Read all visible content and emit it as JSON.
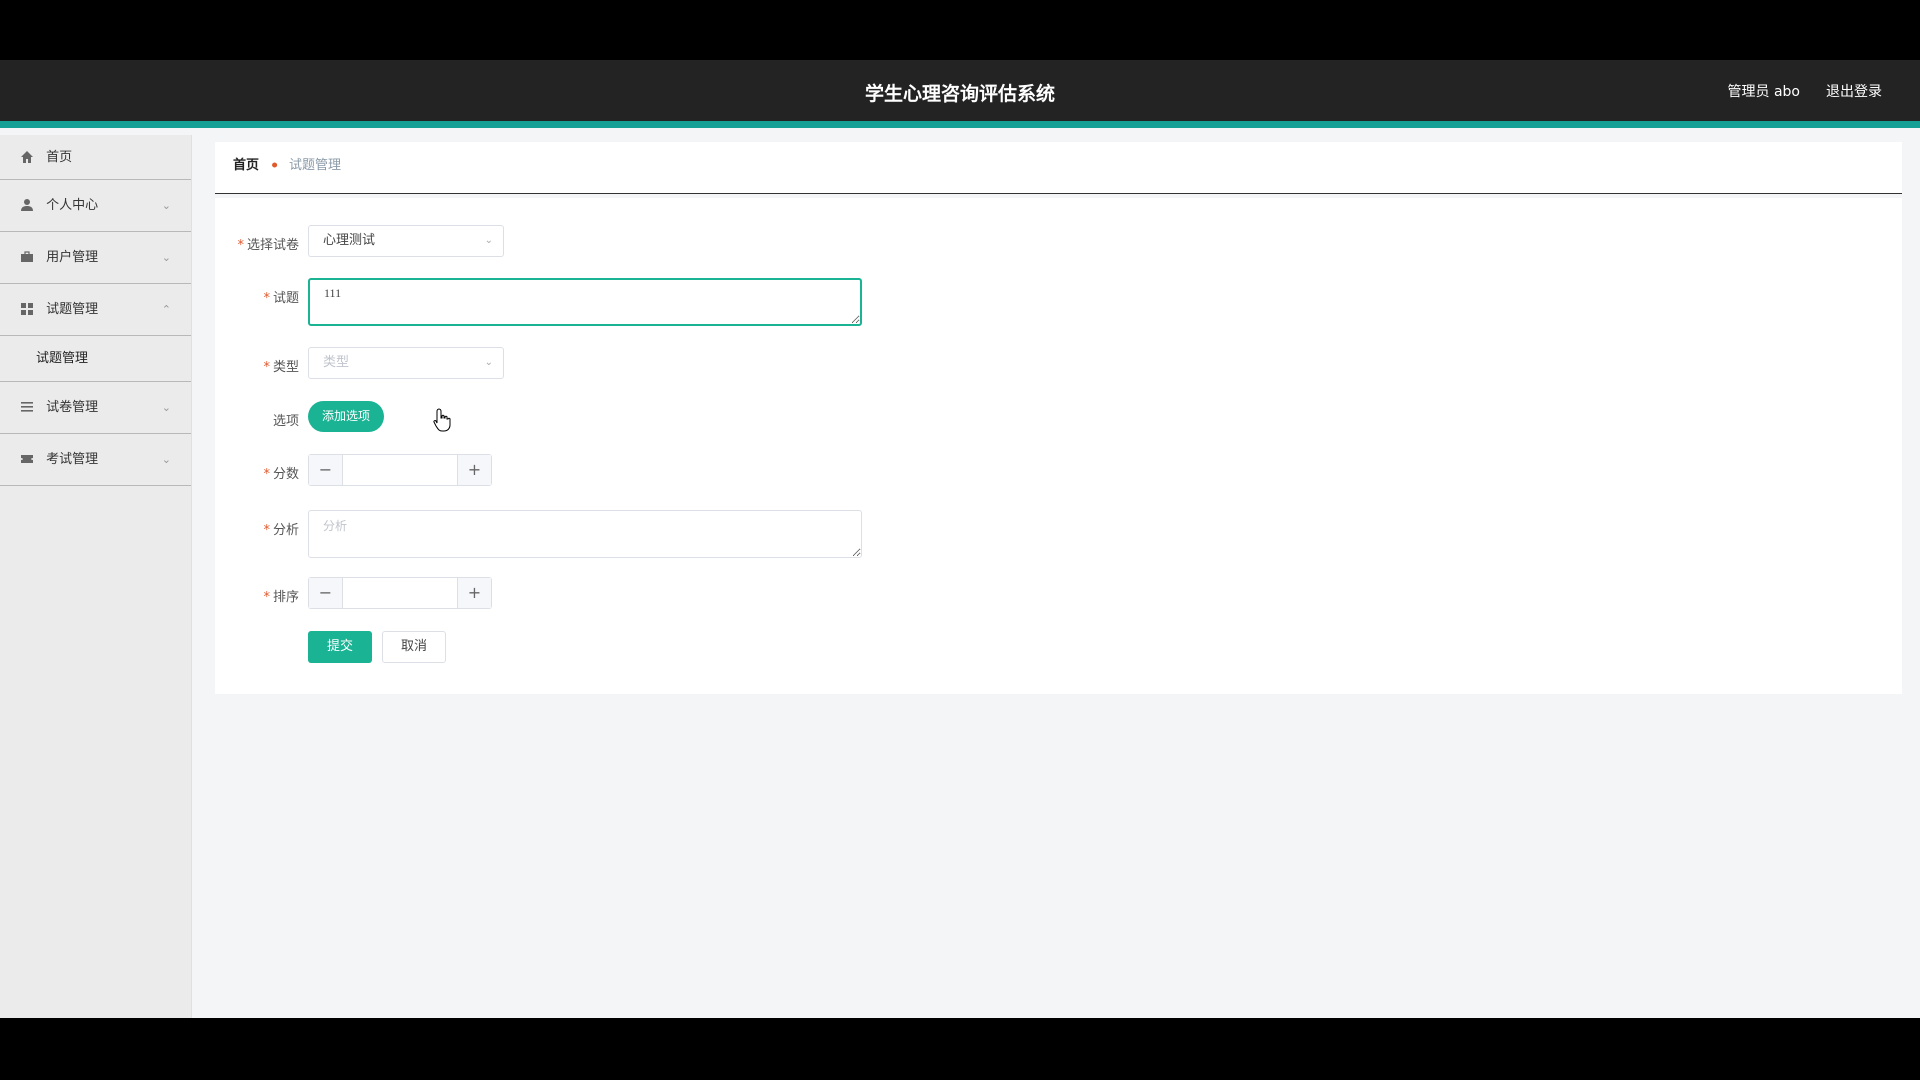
{
  "header": {
    "title": "学生心理咨询评估系统",
    "user": "管理员 abo",
    "logout": "退出登录"
  },
  "sidebar": {
    "items": [
      {
        "label": "首页",
        "icon": "home-icon"
      },
      {
        "label": "个人中心",
        "icon": "user-icon"
      },
      {
        "label": "用户管理",
        "icon": "briefcase-icon"
      },
      {
        "label": "试题管理",
        "icon": "grid-icon",
        "expanded": true
      },
      {
        "label": "试卷管理",
        "icon": "list-icon"
      },
      {
        "label": "考试管理",
        "icon": "ticket-icon"
      }
    ],
    "submenu": {
      "label": "试题管理"
    }
  },
  "breadcrumb": {
    "home": "首页",
    "current": "试题管理"
  },
  "form": {
    "exam_paper": {
      "label": "选择试卷",
      "value": "心理测试"
    },
    "question": {
      "label": "试题",
      "value": "111"
    },
    "type": {
      "label": "类型",
      "placeholder": "类型"
    },
    "options": {
      "label": "选项",
      "add_label": "添加选项"
    },
    "score": {
      "label": "分数",
      "value": ""
    },
    "analysis": {
      "label": "分析",
      "placeholder": "分析"
    },
    "sort": {
      "label": "排序",
      "value": ""
    },
    "submit_label": "提交",
    "cancel_label": "取消"
  },
  "colors": {
    "accent": "#1ab394",
    "header_bg": "#232323",
    "header_border": "#15a095",
    "required": "#e4572e"
  }
}
